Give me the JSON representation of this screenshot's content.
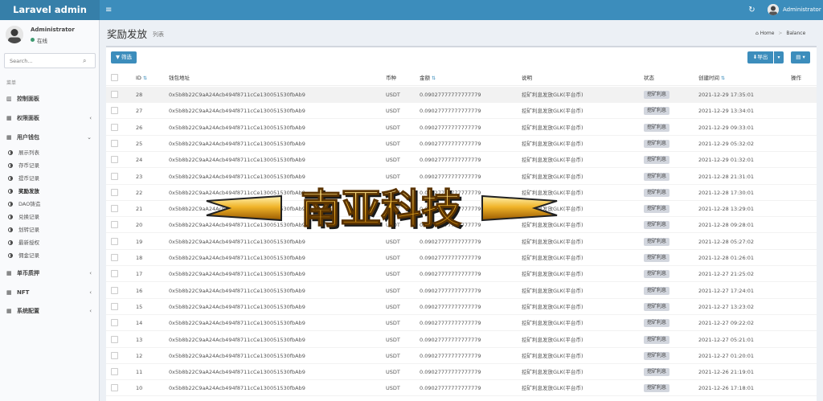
{
  "app": {
    "logo": "Laravel admin",
    "user": "Administrator"
  },
  "sidebar": {
    "user_name": "Administrator",
    "status": "在线",
    "search_placeholder": "Search...",
    "header": "菜单",
    "items": [
      {
        "label": "控制面板",
        "icon": "bar-chart-icon"
      },
      {
        "label": "权限面板",
        "icon": "grid-icon"
      },
      {
        "label": "用户钱包",
        "icon": "grid-icon"
      },
      {
        "label": "单币质押",
        "icon": "grid-icon"
      },
      {
        "label": "NFT",
        "icon": "grid-icon"
      },
      {
        "label": "系统配置",
        "icon": "grid-icon"
      }
    ],
    "subitems": [
      "展示列表",
      "存币记录",
      "提币记录",
      "奖励发放",
      "DAO铸造",
      "兑换记录",
      "划转记录",
      "最新授权",
      "佣金记录"
    ]
  },
  "page": {
    "title": "奖励发放",
    "subtitle": "列表",
    "breadcrumb": {
      "home": "Home",
      "current": "Balance"
    }
  },
  "toolbar": {
    "filter": "筛选",
    "export": "导出"
  },
  "table": {
    "headers": {
      "id": "ID",
      "address": "钱包地址",
      "currency": "币种",
      "amount": "金额",
      "desc": "说明",
      "status": "状态",
      "created": "创建时间",
      "action": "操作"
    },
    "rows": [
      {
        "id": "28",
        "address": "0x5b8b22C9aA24Acb494f8711cCe130051530fbAb9",
        "currency": "USDT",
        "amount": "0.09027777777777779",
        "desc": "挖矿利息发放GLK(平台币)",
        "status": "挖矿利息",
        "created": "2021-12-29 17:35:01"
      },
      {
        "id": "27",
        "address": "0x5b8b22C9aA24Acb494f8711cCe130051530fbAb9",
        "currency": "USDT",
        "amount": "0.09027777777777779",
        "desc": "挖矿利息发放GLK(平台币)",
        "status": "挖矿利息",
        "created": "2021-12-29 13:34:01"
      },
      {
        "id": "26",
        "address": "0x5b8b22C9aA24Acb494f8711cCe130051530fbAb9",
        "currency": "USDT",
        "amount": "0.09027777777777779",
        "desc": "挖矿利息发放GLK(平台币)",
        "status": "挖矿利息",
        "created": "2021-12-29 09:33:01"
      },
      {
        "id": "25",
        "address": "0x5b8b22C9aA24Acb494f8711cCe130051530fbAb9",
        "currency": "USDT",
        "amount": "0.09027777777777779",
        "desc": "挖矿利息发放GLK(平台币)",
        "status": "挖矿利息",
        "created": "2021-12-29 05:32:02"
      },
      {
        "id": "24",
        "address": "0x5b8b22C9aA24Acb494f8711cCe130051530fbAb9",
        "currency": "USDT",
        "amount": "0.09027777777777779",
        "desc": "挖矿利息发放GLK(平台币)",
        "status": "挖矿利息",
        "created": "2021-12-29 01:32:01"
      },
      {
        "id": "23",
        "address": "0x5b8b22C9aA24Acb494f8711cCe130051530fbAb9",
        "currency": "USDT",
        "amount": "0.09027777777777779",
        "desc": "挖矿利息发放GLK(平台币)",
        "status": "挖矿利息",
        "created": "2021-12-28 21:31:01"
      },
      {
        "id": "22",
        "address": "0x5b8b22C9aA24Acb494f8711cCe130051530fbAb9",
        "currency": "USDT",
        "amount": "0.09027777777777779",
        "desc": "挖矿利息发放GLK(平台币)",
        "status": "挖矿利息",
        "created": "2021-12-28 17:30:01"
      },
      {
        "id": "21",
        "address": "0x5b8b22C9aA24Acb494f8711cCe130051530fbAb9",
        "currency": "USDT",
        "amount": "0.09027777777777779",
        "desc": "挖矿利息发放GLK(平台币)",
        "status": "挖矿利息",
        "created": "2021-12-28 13:29:01"
      },
      {
        "id": "20",
        "address": "0x5b8b22C9aA24Acb494f8711cCe130051530fbAb9",
        "currency": "USDT",
        "amount": "0.09027777777777779",
        "desc": "挖矿利息发放GLK(平台币)",
        "status": "挖矿利息",
        "created": "2021-12-28 09:28:01"
      },
      {
        "id": "19",
        "address": "0x5b8b22C9aA24Acb494f8711cCe130051530fbAb9",
        "currency": "USDT",
        "amount": "0.09027777777777779",
        "desc": "挖矿利息发放GLK(平台币)",
        "status": "挖矿利息",
        "created": "2021-12-28 05:27:02"
      },
      {
        "id": "18",
        "address": "0x5b8b22C9aA24Acb494f8711cCe130051530fbAb9",
        "currency": "USDT",
        "amount": "0.09027777777777779",
        "desc": "挖矿利息发放GLK(平台币)",
        "status": "挖矿利息",
        "created": "2021-12-28 01:26:01"
      },
      {
        "id": "17",
        "address": "0x5b8b22C9aA24Acb494f8711cCe130051530fbAb9",
        "currency": "USDT",
        "amount": "0.09027777777777779",
        "desc": "挖矿利息发放GLK(平台币)",
        "status": "挖矿利息",
        "created": "2021-12-27 21:25:02"
      },
      {
        "id": "16",
        "address": "0x5b8b22C9aA24Acb494f8711cCe130051530fbAb9",
        "currency": "USDT",
        "amount": "0.09027777777777779",
        "desc": "挖矿利息发放GLK(平台币)",
        "status": "挖矿利息",
        "created": "2021-12-27 17:24:01"
      },
      {
        "id": "15",
        "address": "0x5b8b22C9aA24Acb494f8711cCe130051530fbAb9",
        "currency": "USDT",
        "amount": "0.09027777777777779",
        "desc": "挖矿利息发放GLK(平台币)",
        "status": "挖矿利息",
        "created": "2021-12-27 13:23:02"
      },
      {
        "id": "14",
        "address": "0x5b8b22C9aA24Acb494f8711cCe130051530fbAb9",
        "currency": "USDT",
        "amount": "0.09027777777777779",
        "desc": "挖矿利息发放GLK(平台币)",
        "status": "挖矿利息",
        "created": "2021-12-27 09:22:02"
      },
      {
        "id": "13",
        "address": "0x5b8b22C9aA24Acb494f8711cCe130051530fbAb9",
        "currency": "USDT",
        "amount": "0.09027777777777779",
        "desc": "挖矿利息发放GLK(平台币)",
        "status": "挖矿利息",
        "created": "2021-12-27 05:21:01"
      },
      {
        "id": "12",
        "address": "0x5b8b22C9aA24Acb494f8711cCe130051530fbAb9",
        "currency": "USDT",
        "amount": "0.09027777777777779",
        "desc": "挖矿利息发放GLK(平台币)",
        "status": "挖矿利息",
        "created": "2021-12-27 01:20:01"
      },
      {
        "id": "11",
        "address": "0x5b8b22C9aA24Acb494f8711cCe130051530fbAb9",
        "currency": "USDT",
        "amount": "0.09027777777777779",
        "desc": "挖矿利息发放GLK(平台币)",
        "status": "挖矿利息",
        "created": "2021-12-26 21:19:01"
      },
      {
        "id": "10",
        "address": "0x5b8b22C9aA24Acb494f8711cCe130051530fbAb9",
        "currency": "USDT",
        "amount": "0.09027777777777779",
        "desc": "挖矿利息发放GLK(平台币)",
        "status": "挖矿利息",
        "created": "2021-12-26 17:18:01"
      }
    ]
  },
  "watermark": {
    "text": "南亚科技"
  },
  "colors": {
    "header": "#3c8dbc",
    "logo": "#367fa9",
    "primary": "#3c8dbc",
    "sidebar": "#f9fafc",
    "online": "#3d9970",
    "badge": "#d2d6de"
  }
}
